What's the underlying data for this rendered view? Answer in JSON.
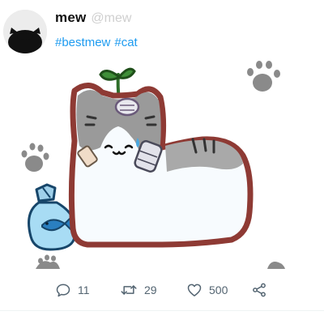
{
  "post": {
    "display_name": "mew",
    "handle": "@mew",
    "hashtags": [
      "#bestmew",
      "#cat"
    ],
    "image_icon": "cat-illustration",
    "avatar_icon": "cat-avatar-icon"
  },
  "actions": {
    "reply": {
      "icon": "reply-icon",
      "count": "11"
    },
    "retweet": {
      "icon": "retweet-icon",
      "count": "29"
    },
    "like": {
      "icon": "heart-icon",
      "count": "500"
    },
    "share": {
      "icon": "share-icon"
    }
  },
  "colors": {
    "hashtag": "#1d9bf0",
    "action_gray": "#536471",
    "cat_outline": "#8e3a34",
    "cat_gray": "#8f8f8f",
    "sprout": "#3f8f38"
  }
}
